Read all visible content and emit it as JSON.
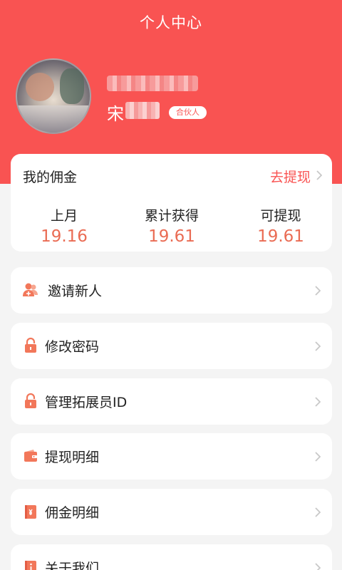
{
  "header": {
    "title": "个人中心"
  },
  "profile": {
    "name_visible": "宋",
    "role_badge": "合伙人"
  },
  "commission": {
    "title": "我的佣金",
    "withdraw_label": "去提现",
    "stats": [
      {
        "label": "上月",
        "value": "19.16"
      },
      {
        "label": "累计获得",
        "value": "19.61"
      },
      {
        "label": "可提现",
        "value": "19.61"
      }
    ]
  },
  "menu": [
    {
      "label": "邀请新人",
      "icon": "invite-user-icon"
    },
    {
      "label": "修改密码",
      "icon": "lock-icon"
    },
    {
      "label": "管理拓展员ID",
      "icon": "lock-icon"
    },
    {
      "label": "提现明细",
      "icon": "wallet-icon"
    },
    {
      "label": "佣金明细",
      "icon": "ledger-icon"
    },
    {
      "label": "关于我们",
      "icon": "info-book-icon"
    }
  ],
  "colors": {
    "brand": "#f95352",
    "accent_value": "#ea6c54",
    "icon": "#f2775a",
    "background": "#f4f4f4"
  }
}
